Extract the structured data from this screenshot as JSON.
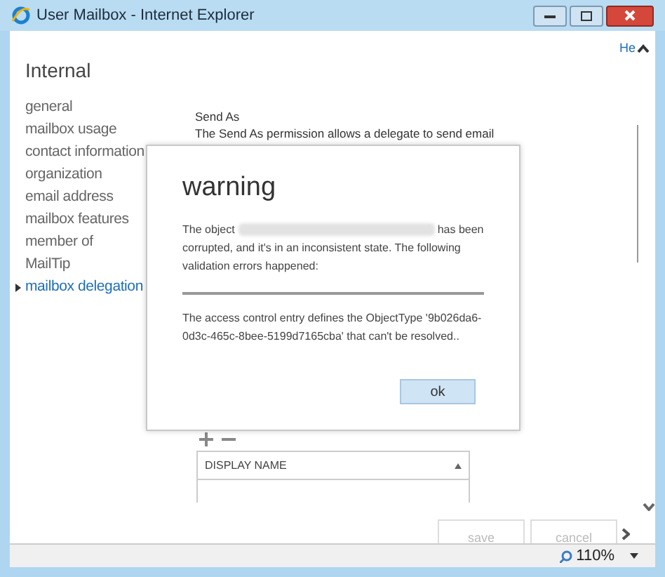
{
  "window": {
    "title": "User Mailbox - Internet Explorer"
  },
  "help_link": "He",
  "page_title": "Internal",
  "nav": [
    {
      "label": "general",
      "selected": false
    },
    {
      "label": "mailbox usage",
      "selected": false
    },
    {
      "label": "contact information",
      "selected": false
    },
    {
      "label": "organization",
      "selected": false
    },
    {
      "label": "email address",
      "selected": false
    },
    {
      "label": "mailbox features",
      "selected": false
    },
    {
      "label": "member of",
      "selected": false
    },
    {
      "label": "MailTip",
      "selected": false
    },
    {
      "label": "mailbox delegation",
      "selected": true
    }
  ],
  "section": {
    "heading": "Send As",
    "description": "The Send As permission allows a delegate to send email"
  },
  "table": {
    "columns": [
      {
        "label": "DISPLAY NAME"
      }
    ]
  },
  "form_buttons": [
    {
      "label": "save",
      "disabled": true
    },
    {
      "label": "cancel",
      "disabled": true
    }
  ],
  "dialog": {
    "title": "warning",
    "message_start": "The object",
    "message_end": "has been corrupted, and it's in an inconsistent state. The following validation errors happened:",
    "error": "The access control entry defines the ObjectType '9b026da6-0d3c-465c-8bee-5199d7165cba' that can't be resolved..",
    "button": "ok"
  },
  "status_bar": {
    "zoom": "110%"
  }
}
